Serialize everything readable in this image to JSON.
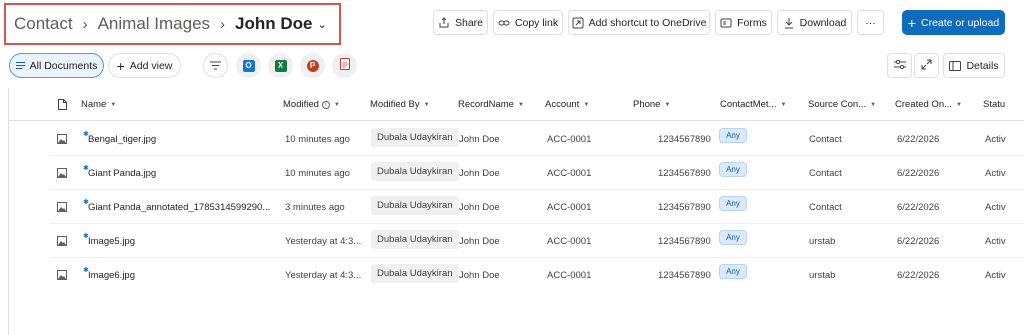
{
  "breadcrumb": {
    "items": [
      "Contact",
      "Animal Images"
    ],
    "current": "John Doe"
  },
  "command_bar": {
    "share": "Share",
    "copy_link": "Copy link",
    "add_shortcut": "Add shortcut to OneDrive",
    "forms": "Forms",
    "download": "Download",
    "more": "···",
    "create": "Create or upload"
  },
  "view_bar": {
    "all_documents": "All Documents",
    "add_view": "Add view",
    "details": "Details"
  },
  "columns": {
    "name": "Name",
    "modified": "Modified",
    "modified_by": "Modified By",
    "record_name": "RecordName",
    "account": "Account",
    "phone": "Phone",
    "contact_method": "ContactMet...",
    "source_con": "Source Con...",
    "created_on": "Created On...",
    "status": "Statu"
  },
  "rows": [
    {
      "name": "Bengal_tiger.jpg",
      "modified": "10 minutes ago",
      "modified_by": "Dubala Udaykiran",
      "record_name": "John Doe",
      "account": "ACC-0001",
      "phone": "1234567890",
      "contact_method": "Any",
      "source": "Contact",
      "created_on": "6/22/2026",
      "status": "Activ"
    },
    {
      "name": "Giant Panda.jpg",
      "modified": "10 minutes ago",
      "modified_by": "Dubala Udaykiran",
      "record_name": "John Doe",
      "account": "ACC-0001",
      "phone": "1234567890",
      "contact_method": "Any",
      "source": "Contact",
      "created_on": "6/22/2026",
      "status": "Activ"
    },
    {
      "name": "Giant Panda_annotated_1785314599290...",
      "modified": "3 minutes ago",
      "modified_by": "Dubala Udaykiran",
      "record_name": "John Doe",
      "account": "ACC-0001",
      "phone": "1234567890",
      "contact_method": "Any",
      "source": "Contact",
      "created_on": "6/22/2026",
      "status": "Activ"
    },
    {
      "name": "Image5.jpg",
      "modified": "Yesterday at 4:3...",
      "modified_by": "Dubala Udaykiran",
      "record_name": "John Doe",
      "account": "ACC-0001",
      "phone": "1234567890",
      "contact_method": "Any",
      "source": "urstab",
      "created_on": "6/22/2026",
      "status": "Activ"
    },
    {
      "name": "Image6.jpg",
      "modified": "Yesterday at 4:3...",
      "modified_by": "Dubala Udaykiran",
      "record_name": "John Doe",
      "account": "ACC-0001",
      "phone": "1234567890",
      "contact_method": "Any",
      "source": "urstab",
      "created_on": "6/22/2026",
      "status": "Activ"
    }
  ],
  "colors": {
    "accent": "#0f6cbd",
    "highlight_border": "#d9534f",
    "selected_view_bg": "#ebf3fc",
    "outlook": "#0f78d4",
    "excel": "#107c41",
    "powerpoint": "#c43e1c",
    "pdf": "#d13438"
  }
}
